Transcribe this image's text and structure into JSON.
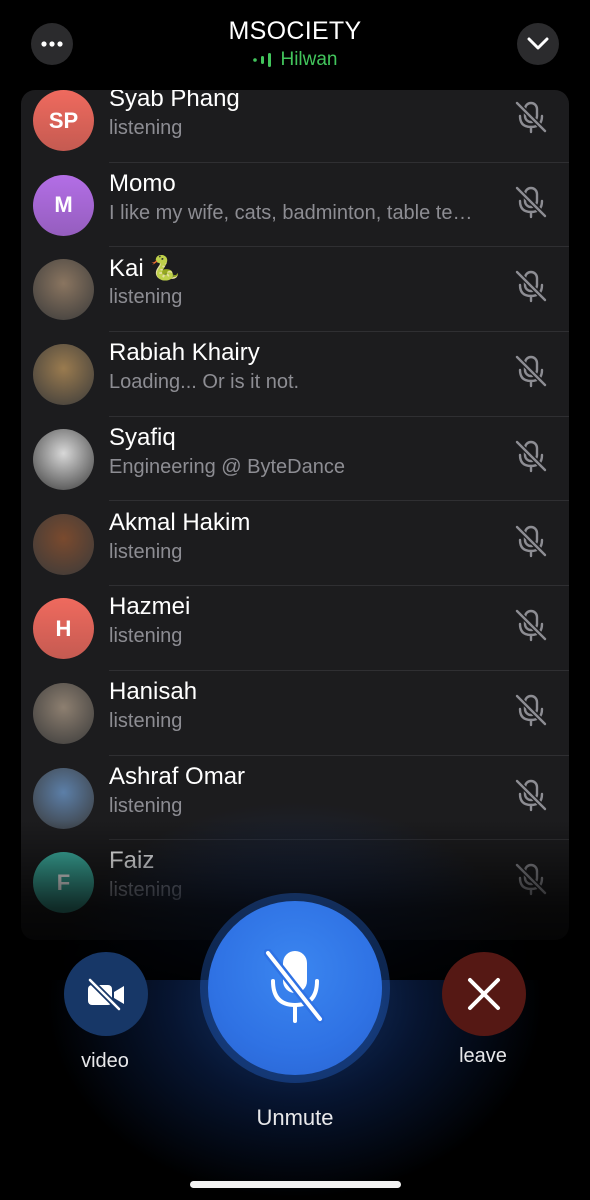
{
  "header": {
    "title": "MSOCIETY",
    "speaker": "Hilwan"
  },
  "participants": [
    {
      "name": "Syab Phang",
      "status": "listening",
      "initials": "SP",
      "avatar_color": "#ef6a5e"
    },
    {
      "name": "Momo",
      "status": "I like my wife, cats, badminton, table te…",
      "initials": "M",
      "avatar_color": "#b36ee6"
    },
    {
      "name": "Kai 🐍",
      "status": "listening",
      "initials": "",
      "avatar_color": "#8a7560"
    },
    {
      "name": "Rabiah Khairy",
      "status": "Loading... Or is it not.",
      "initials": "",
      "avatar_color": "#9a7b4f"
    },
    {
      "name": "Syafiq",
      "status": "Engineering @ ByteDance",
      "initials": "",
      "avatar_color": "#d8d8d8"
    },
    {
      "name": "Akmal Hakim",
      "status": "listening",
      "initials": "",
      "avatar_color": "#7a4a2e"
    },
    {
      "name": "Hazmei",
      "status": "listening",
      "initials": "H",
      "avatar_color": "#ef6a5e"
    },
    {
      "name": "Hanisah",
      "status": "listening",
      "initials": "",
      "avatar_color": "#8d7f70"
    },
    {
      "name": "Ashraf Omar",
      "status": "listening",
      "initials": "",
      "avatar_color": "#5c7fa8"
    },
    {
      "name": "Faiz",
      "status": "listening",
      "initials": "F",
      "avatar_color": "#3fb8a8"
    }
  ],
  "controls": {
    "video_label": "video",
    "unmute_label": "Unmute",
    "leave_label": "leave"
  },
  "colors": {
    "accent_blue": "#2f72e4",
    "speaking_green": "#42c55c",
    "leave_red": "#551814"
  }
}
